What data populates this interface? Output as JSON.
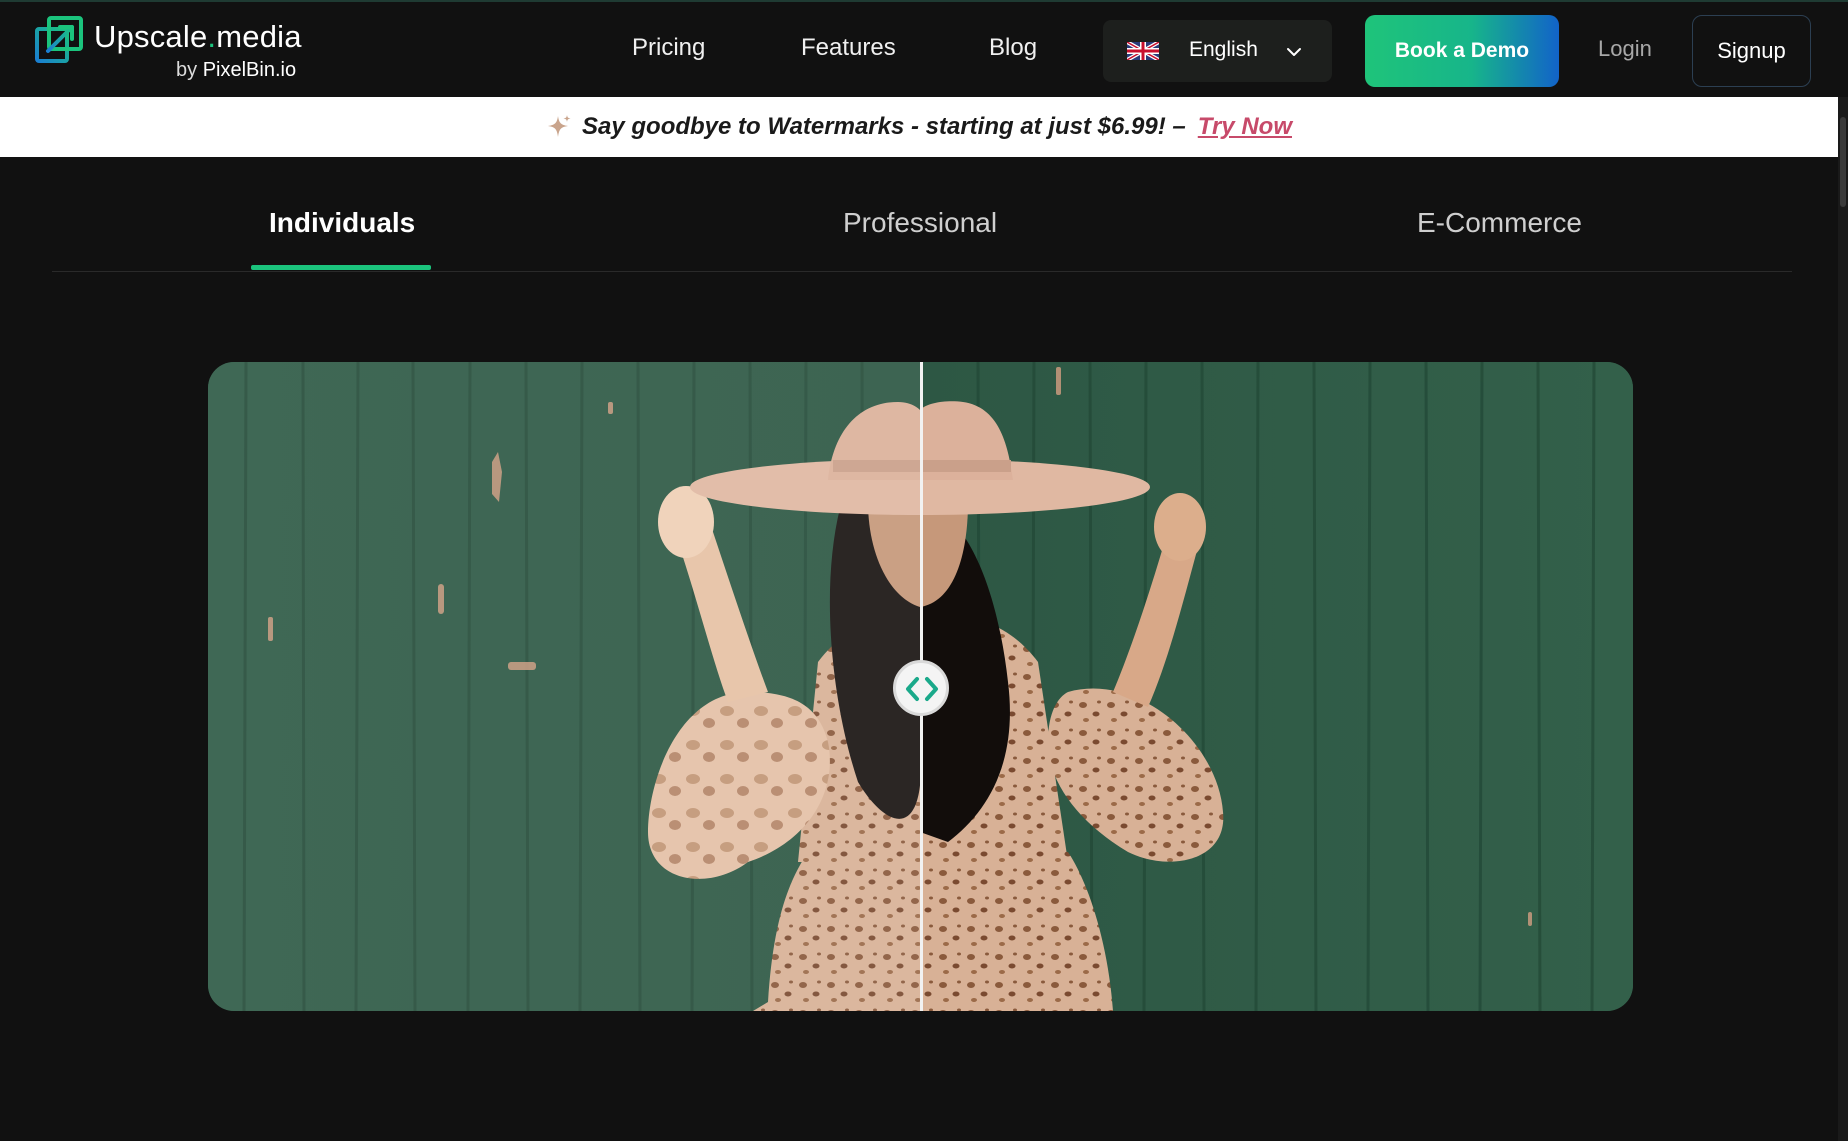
{
  "header": {
    "logo": {
      "name_main": "Upscale",
      "name_dot": ".",
      "name_tld": "media",
      "sub_by": "by ",
      "sub_brand": "PixelBin.io"
    },
    "nav": {
      "pricing": "Pricing",
      "features": "Features",
      "blog": "Blog"
    },
    "language": {
      "selected": "English",
      "flag_icon": "uk-flag-icon",
      "chevron_icon": "chevron-down-icon"
    },
    "book_demo": "Book a Demo",
    "login": "Login",
    "signup": "Signup"
  },
  "banner": {
    "icon": "sparkle-icon",
    "text": "Say goodbye to Watermarks - starting at just $6.99! –",
    "link": "Try Now"
  },
  "tabs": {
    "items": [
      {
        "label": "Individuals",
        "active": true
      },
      {
        "label": "Professional",
        "active": false
      },
      {
        "label": "E-Commerce",
        "active": false
      }
    ]
  },
  "comparison": {
    "handle_icon": "compare-arrows-icon",
    "position_percent": 50
  },
  "colors": {
    "background": "#111111",
    "accent_green": "#1bc47d",
    "demo_gradient_end": "#1263c9",
    "promo_link": "#c74a6a",
    "wall_green": "#2e5a45"
  }
}
